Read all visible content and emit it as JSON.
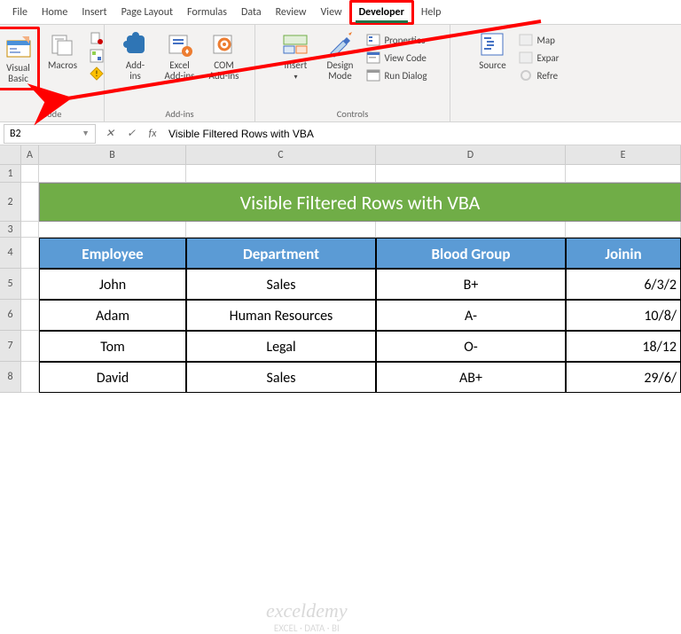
{
  "tabs": [
    "File",
    "Home",
    "Insert",
    "Page Layout",
    "Formulas",
    "Data",
    "Review",
    "View",
    "Developer",
    "Help"
  ],
  "active_tab": "Developer",
  "ribbon": {
    "code": {
      "label": "Code",
      "visual_basic": "Visual\nBasic",
      "macros": "Macros"
    },
    "addins": {
      "label": "Add-ins",
      "addins": "Add-\nins",
      "excel": "Excel\nAdd-ins",
      "com": "COM\nAdd-ins"
    },
    "controls": {
      "label": "Controls",
      "insert": "Insert",
      "design": "Design\nMode",
      "properties": "Properties",
      "view_code": "View Code",
      "run_dialog": "Run Dialog"
    },
    "xml": {
      "source": "Source",
      "map": "Map",
      "expa": "Expar",
      "refre": "Refre"
    }
  },
  "namebox": "B2",
  "formula": "Visible Filtered Rows with VBA",
  "cols": [
    "A",
    "B",
    "C",
    "D",
    "E"
  ],
  "title": "Visible Filtered Rows with VBA",
  "table": {
    "headers": [
      "Employee",
      "Department",
      "Blood Group",
      "Joinin"
    ],
    "rows": [
      [
        "John",
        "Sales",
        "B+",
        "6/3/2"
      ],
      [
        "Adam",
        "Human Resources",
        "A-",
        "10/8/"
      ],
      [
        "Tom",
        "Legal",
        "O-",
        "18/12"
      ],
      [
        "David",
        "Sales",
        "AB+",
        "29/6/"
      ]
    ]
  },
  "chart_data": {
    "type": "table",
    "headers": [
      "Employee",
      "Department",
      "Blood Group",
      "Joining"
    ],
    "rows": [
      [
        "John",
        "Sales",
        "B+",
        "6/3/2"
      ],
      [
        "Adam",
        "Human Resources",
        "A-",
        "10/8/"
      ],
      [
        "Tom",
        "Legal",
        "O-",
        "18/12"
      ],
      [
        "David",
        "Sales",
        "AB+",
        "29/6/"
      ]
    ]
  },
  "watermark": {
    "brand": "exceldemy",
    "tag": "EXCEL · DATA · BI"
  }
}
